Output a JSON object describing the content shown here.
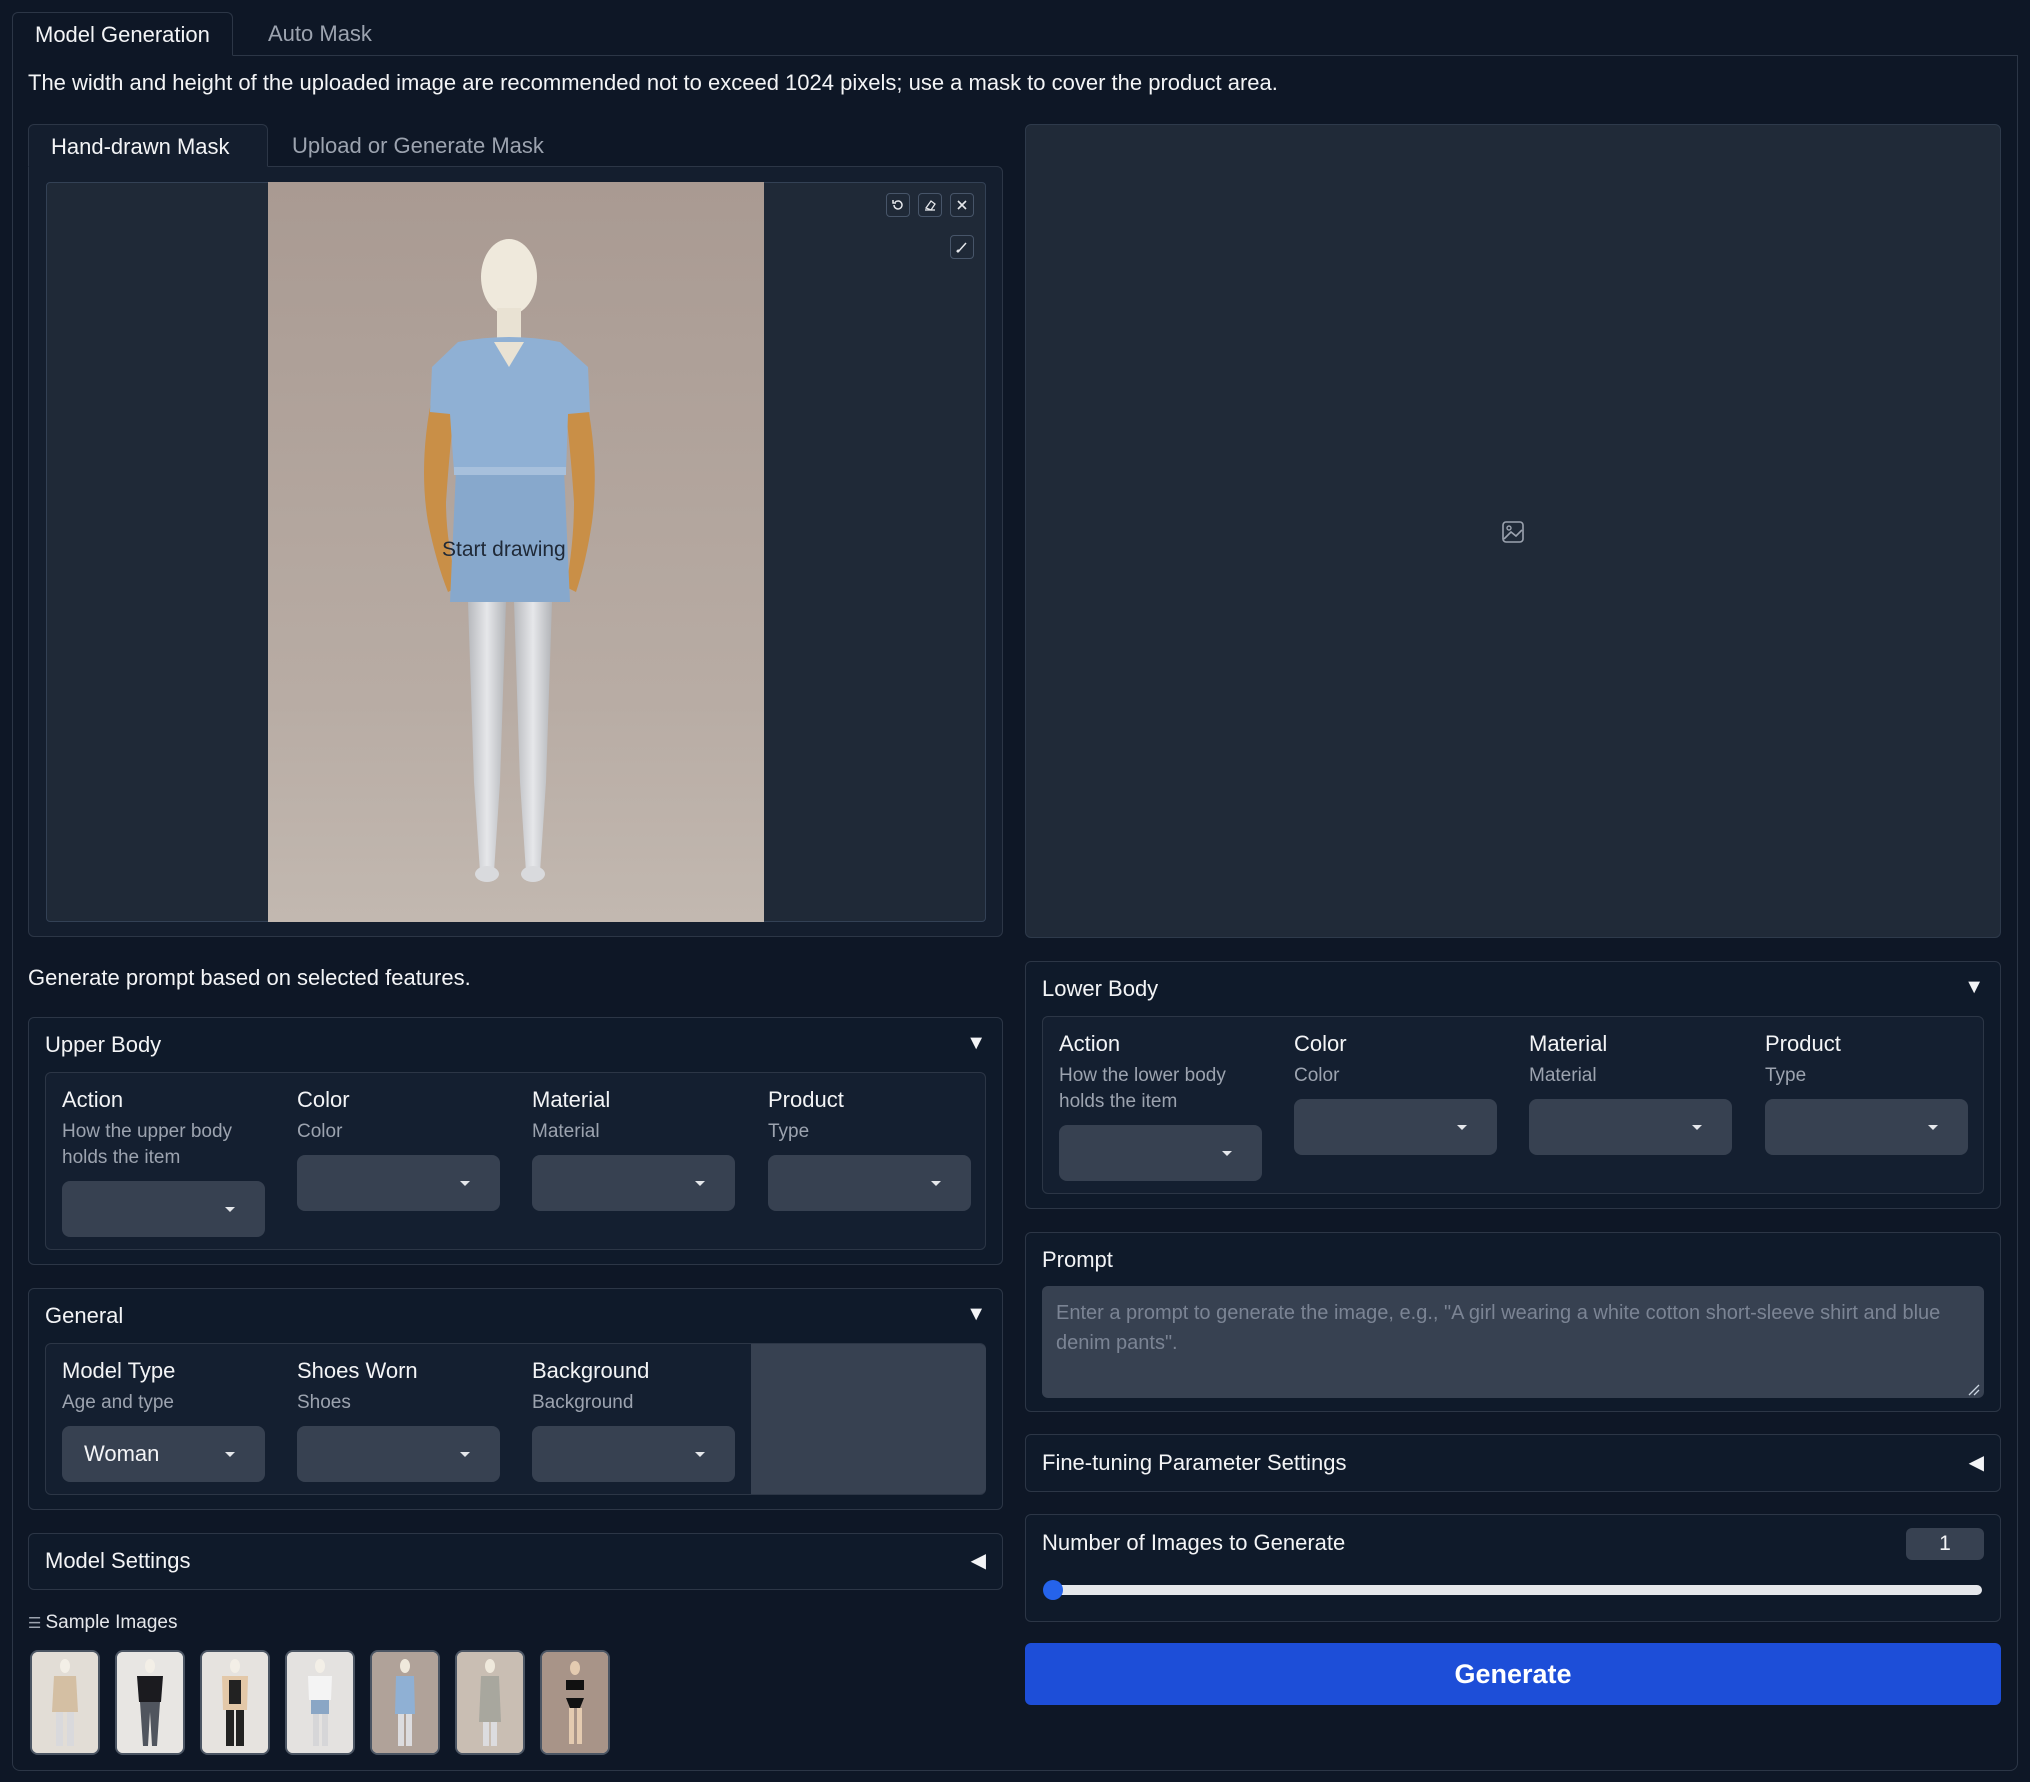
{
  "tabs": [
    "Model Generation",
    "Auto Mask"
  ],
  "note": "The width and height of the uploaded image are recommended not to exceed 1024 pixels; use a mask to cover the product area.",
  "mask_tabs": [
    "Hand-drawn Mask",
    "Upload or Generate Mask"
  ],
  "canvas": {
    "hint": "Start drawing"
  },
  "prompt_section_label": "Generate prompt based on selected features.",
  "upper_body": {
    "title": "Upper Body",
    "fields": [
      {
        "label": "Action",
        "info": "How the upper body holds the item",
        "value": ""
      },
      {
        "label": "Color",
        "info": "Color",
        "value": ""
      },
      {
        "label": "Material",
        "info": "Material",
        "value": ""
      },
      {
        "label": "Product",
        "info": "Type",
        "value": ""
      }
    ]
  },
  "general": {
    "title": "General",
    "fields": [
      {
        "label": "Model Type",
        "info": "Age and type",
        "value": "Woman"
      },
      {
        "label": "Shoes Worn",
        "info": "Shoes",
        "value": ""
      },
      {
        "label": "Background",
        "info": "Background",
        "value": ""
      }
    ]
  },
  "model_settings": {
    "title": "Model Settings"
  },
  "samples": {
    "title": "Sample Images"
  },
  "lower_body": {
    "title": "Lower Body",
    "fields": [
      {
        "label": "Action",
        "info": "How the lower body holds the item",
        "value": ""
      },
      {
        "label": "Color",
        "info": "Color",
        "value": ""
      },
      {
        "label": "Material",
        "info": "Material",
        "value": ""
      },
      {
        "label": "Product",
        "info": "Type",
        "value": ""
      }
    ]
  },
  "prompt": {
    "label": "Prompt",
    "placeholder": "Enter a prompt to generate the image,  e.g., \"A girl wearing a white cotton short-sleeve shirt and blue denim pants\"."
  },
  "fine_tuning": {
    "title": "Fine-tuning Parameter Settings"
  },
  "num_images": {
    "label": "Number of Images to Generate",
    "value": "1"
  },
  "generate_label": "Generate",
  "colors": {
    "accent": "#1d4ed8",
    "background": "#0e1726"
  }
}
